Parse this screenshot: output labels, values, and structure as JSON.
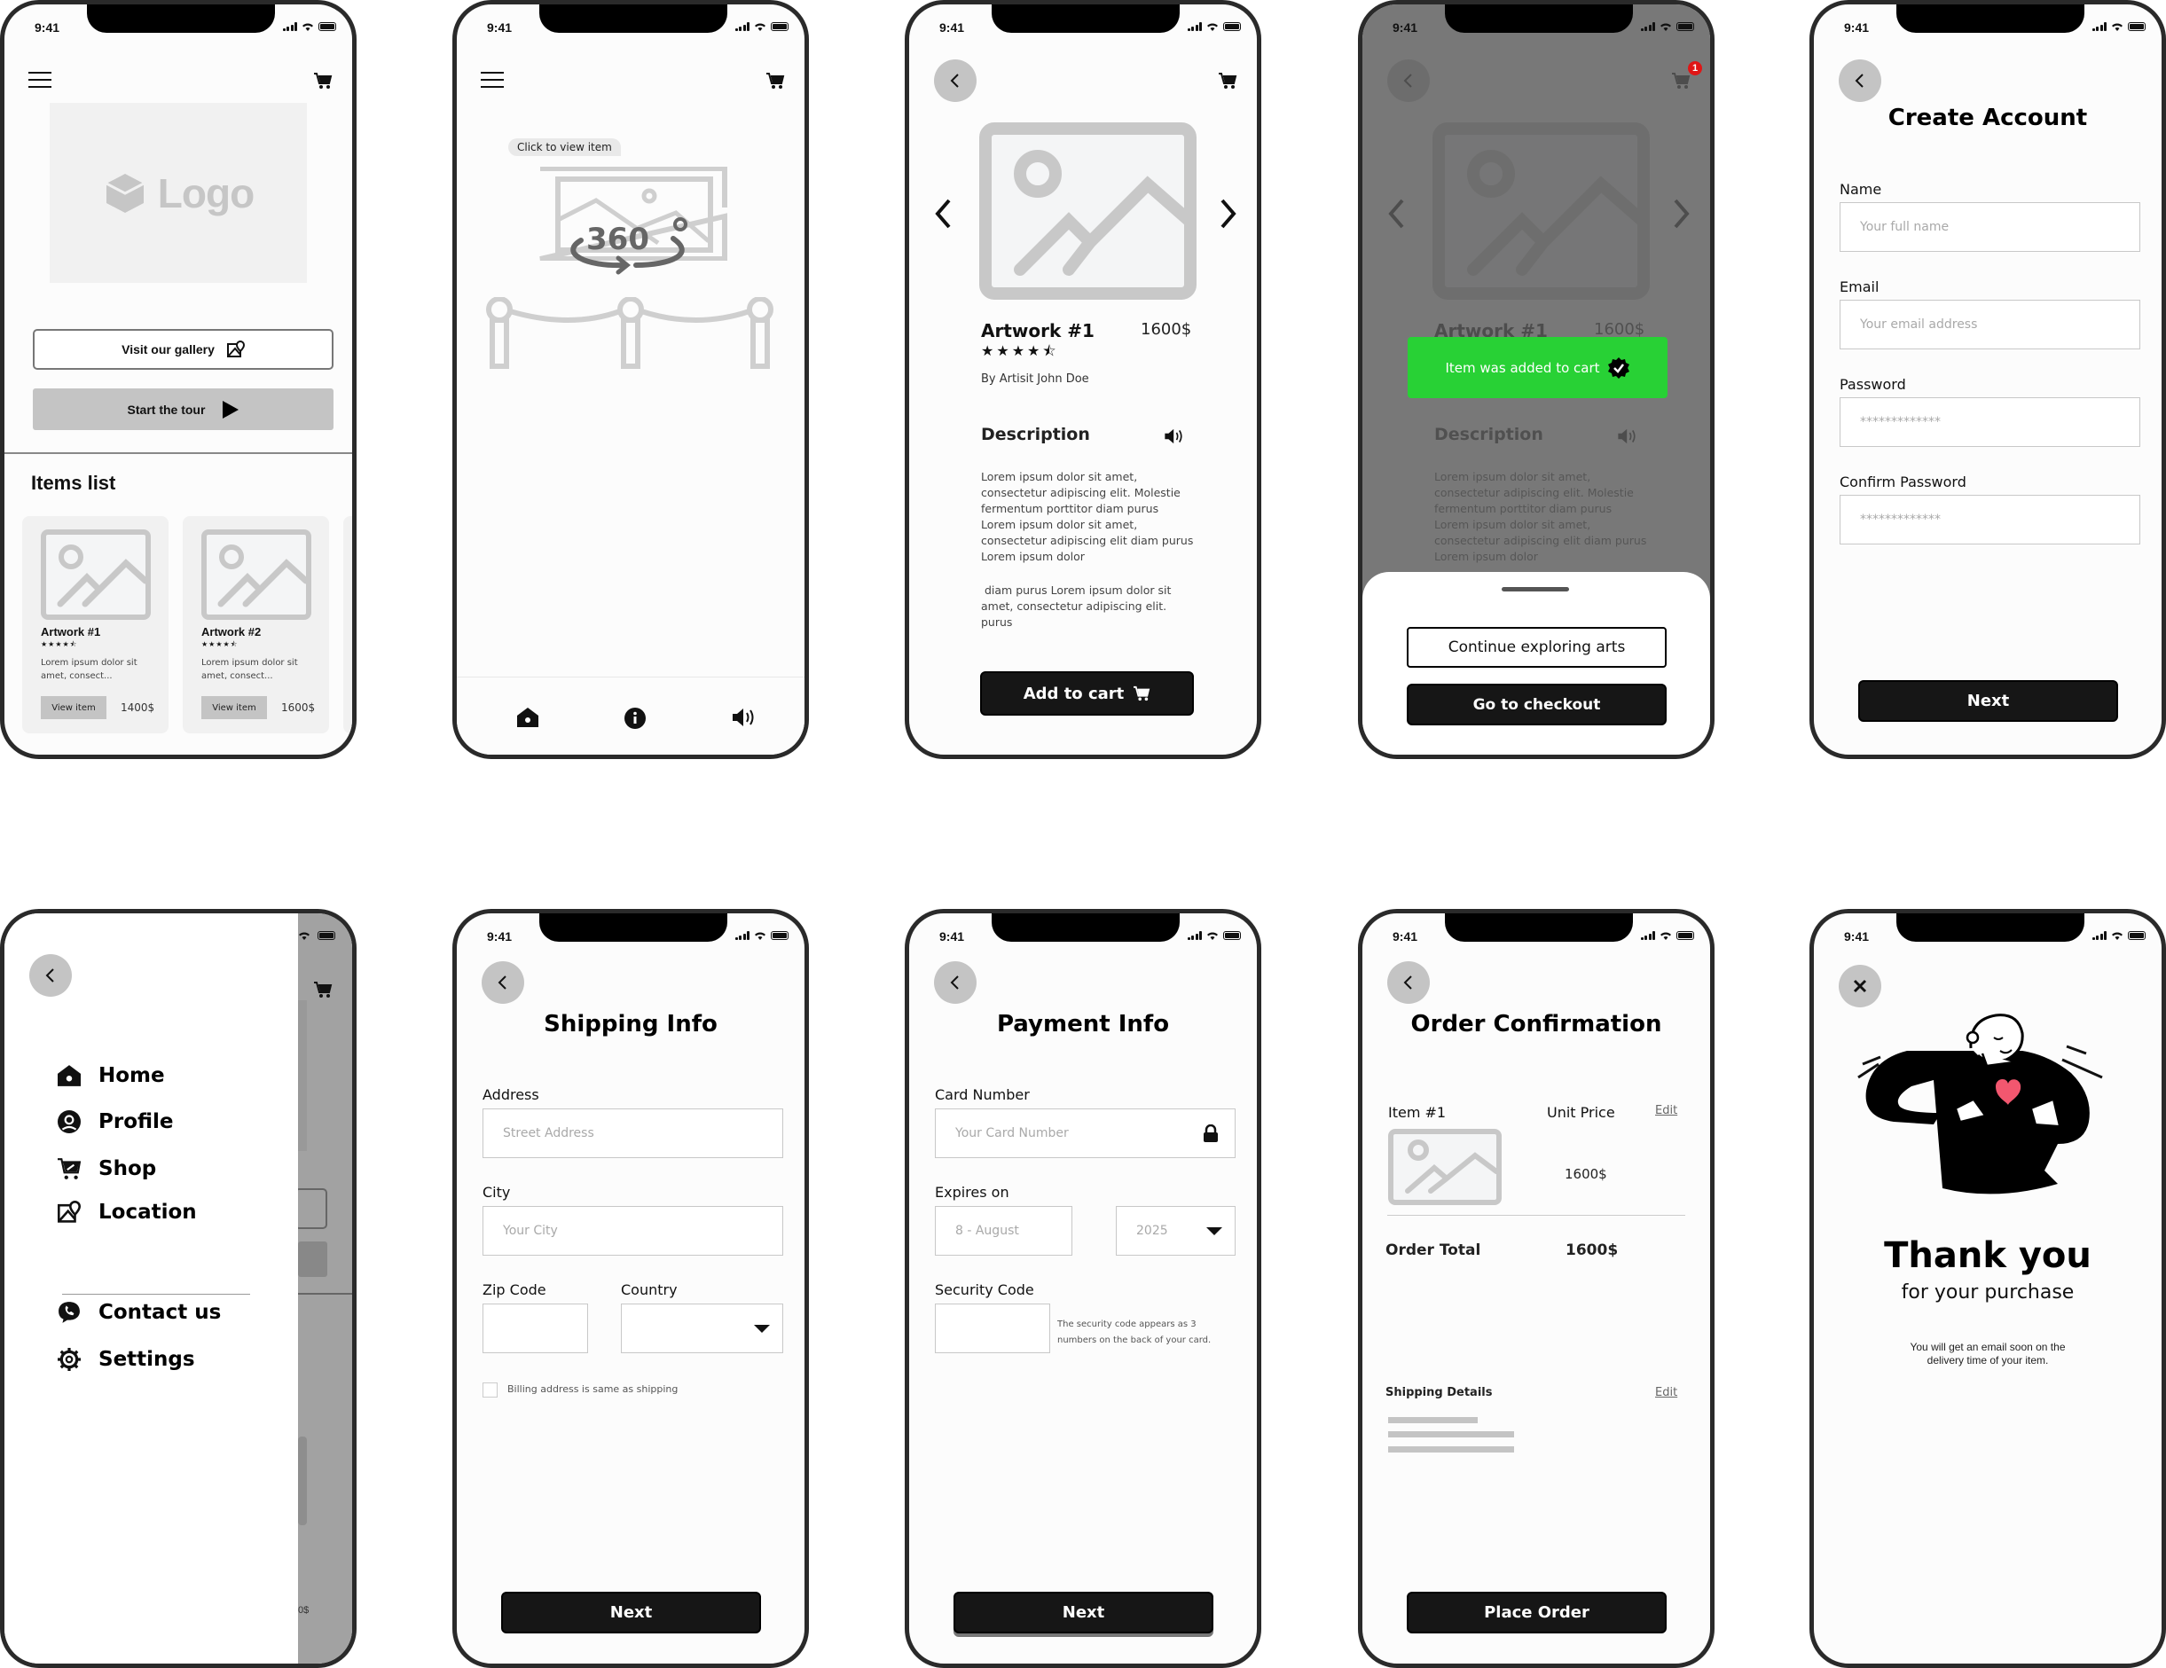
{
  "status_bar": {
    "time": "9:41"
  },
  "screens": {
    "home": {
      "logo_text": "Logo",
      "visit_gallery_label": "Visit our gallery",
      "start_tour_label": "Start the tour",
      "items_list_title": "Items list",
      "items": [
        {
          "title": "Artwork #1",
          "rating": "★★★★⯪",
          "description": "Lorem ipsum dolor sit amet, consect...",
          "button": "View item",
          "price": "1400$"
        },
        {
          "title": "Artwork #2",
          "rating": "★★★★⯪",
          "description": "Lorem ipsum dolor sit amet, consect...",
          "button": "View item",
          "price": "1600$"
        }
      ]
    },
    "gallery": {
      "tooltip": "Click to view item",
      "badge_360": "360",
      "bottom_nav": [
        "home-icon",
        "info-icon",
        "speaker-icon"
      ]
    },
    "item_detail": {
      "title": "Artwork #1",
      "price": "1600$",
      "rating": "★★★★⯪",
      "artist": "By Artisit John Doe",
      "description_heading": "Description",
      "description_p1": "Lorem ipsum dolor sit amet, consectetur adipiscing elit. Molestie fermentum porttitor diam purus Lorem ipsum dolor sit amet, consectetur adipiscing elit diam purus Lorem ipsum dolor",
      "description_p2": " diam purus Lorem ipsum dolor sit amet, consectetur adipiscing elit.  purus",
      "add_to_cart_label": "Add to cart"
    },
    "added_to_cart": {
      "cart_badge": "1",
      "toast": "Item was added to cart",
      "toast_color": "#28d135",
      "continue_label": "Continue exploring arts",
      "checkout_label": "Go to checkout"
    },
    "create_account": {
      "title": "Create Account",
      "fields": [
        {
          "label": "Name",
          "placeholder": "Your full name"
        },
        {
          "label": "Email",
          "placeholder": "Your email address"
        },
        {
          "label": "Password",
          "placeholder": "*************"
        },
        {
          "label": "Confirm Password",
          "placeholder": "*************"
        }
      ],
      "next_label": "Next"
    },
    "menu": {
      "items": [
        {
          "label": "Home",
          "icon": "home-icon"
        },
        {
          "label": "Profile",
          "icon": "profile-icon"
        },
        {
          "label": "Shop",
          "icon": "shop-cart-icon"
        },
        {
          "label": "Location",
          "icon": "map-location-icon"
        }
      ],
      "secondary_items": [
        {
          "label": "Contact us",
          "icon": "phone-chat-icon"
        },
        {
          "label": "Settings",
          "icon": "gear-icon"
        }
      ],
      "behind_price": "0$"
    },
    "shipping": {
      "title": "Shipping Info",
      "address_label": "Address",
      "address_placeholder": "Street Address",
      "city_label": "City",
      "city_placeholder": "Your City",
      "zip_label": "Zip Code",
      "zip_value": "",
      "country_label": "Country",
      "country_value": "",
      "billing_checkbox_label": "Billing address is same as shipping",
      "billing_checked": false,
      "next_label": "Next"
    },
    "payment": {
      "title": "Payment Info",
      "card_label": "Card Number",
      "card_placeholder": "Your Card Number",
      "expires_label": "Expires on",
      "month_value": "8 - August",
      "year_value": "2025",
      "security_label": "Security Code",
      "security_value": "",
      "security_hint": "The security code appears as 3 numbers on the back of your card.",
      "next_label": "Next"
    },
    "order_confirmation": {
      "title": "Order Confirmation",
      "item_label": "Item #1",
      "unit_price_label": "Unit Price",
      "edit_label": "Edit",
      "unit_price": "1600$",
      "order_total_label": "Order Total",
      "order_total": "1600$",
      "shipping_details_label": "Shipping Details",
      "shipping_edit_label": "Edit",
      "place_order_label": "Place Order"
    },
    "thank_you": {
      "heading": "Thank you",
      "subheading": "for your purchase",
      "message": "You will get an email soon on the delivery  time of your item.",
      "heart_color": "#f2576f"
    }
  }
}
